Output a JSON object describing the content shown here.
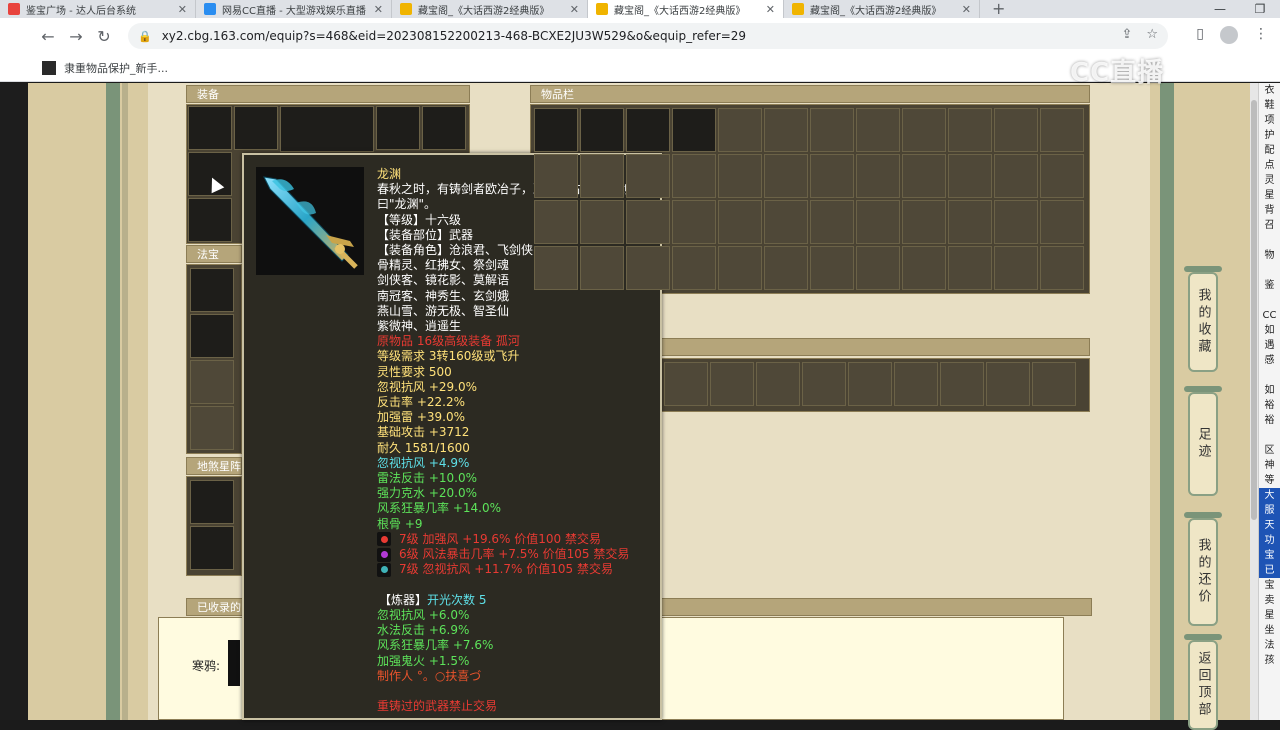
{
  "browser": {
    "tabs": [
      {
        "label": "鉴宝广场 - 达人后台系统",
        "favicon_color": "#e8433d",
        "active": false
      },
      {
        "label": "网易CC直播 - 大型游戏娱乐直播",
        "favicon_color": "#2a8df0",
        "active": false
      },
      {
        "label": "藏宝阁_《大话西游2经典版》",
        "favicon_color": "#f0b400",
        "active": false
      },
      {
        "label": "藏宝阁_《大话西游2经典版》",
        "favicon_color": "#f0b400",
        "active": true
      },
      {
        "label": "藏宝阁_《大话西游2经典版》",
        "favicon_color": "#f0b400",
        "active": false
      }
    ],
    "new_tab_glyph": "+",
    "window_controls": [
      "—",
      "❐"
    ],
    "url": "xy2.cbg.163.com/equip?s=468&eid=202308152200213-468-BCXE2JU3W529&o&equip_refer=29",
    "bookmark": "隶重物品保护_新手..."
  },
  "watermark": "CC直播",
  "page": {
    "equip_panel_title": "装备",
    "inventory_panel_title": "物品栏",
    "fabao_panel_title": "法宝",
    "star_panel_title": "地煞星阵",
    "shoulu_panel_title": "已收录的",
    "hanya_label": "寒鸦:",
    "side_buttons": [
      "我的收藏",
      "足迹",
      "我的还价",
      "返回顶部"
    ],
    "right_edge_chars": [
      "衣",
      "鞋",
      "项",
      "护",
      "配",
      "点",
      "灵",
      "星",
      "背",
      "召",
      "",
      "物",
      "",
      "鉴",
      "",
      "CC",
      "如",
      "遇",
      "感",
      "",
      "如",
      "裕",
      "裕",
      "",
      "区",
      "神",
      "等",
      "大",
      "服",
      "天",
      "功",
      "宝",
      "已",
      "宝",
      "卖",
      "星",
      "坐",
      "法",
      "孩"
    ]
  },
  "tooltip": {
    "name": "龙渊",
    "description": "春秋之时，有铸剑者欧冶子，冶铸旷古第一铁剑，名曰\"龙渊\"。",
    "level": "【等级】十六级",
    "slot": "【装备部位】武器",
    "roles_label": "【装备角色】沧浪君、飞剑侠",
    "roles": [
      "骨精灵、红拂女、祭剑魂",
      "剑侠客、镜花影、莫解语",
      "南冠客、神秀生、玄剑娥",
      "燕山雪、游无极、智圣仙",
      "紫微神、逍遥生"
    ],
    "origin": "原物品 16级高级装备 孤河",
    "requirements": [
      "等级需求 3转160级或飞升",
      "灵性要求 500"
    ],
    "base_stats": [
      "忽视抗风 +29.0%",
      "反击率 +22.2%",
      "加强雷 +39.0%",
      "基础攻击 +3712",
      "耐久 1581/1600"
    ],
    "extra_stat_cyan": "忽视抗风 +4.9%",
    "extra_stats": [
      "雷法反击 +10.0%",
      "强力克水 +20.0%",
      "风系狂暴几率 +14.0%",
      "根骨 +9"
    ],
    "gems": [
      {
        "text": "7级 加强风 +19.6% 价值100 禁交易",
        "color": "#e83a33"
      },
      {
        "text": "6级 风法暴击几率 +7.5% 价值105 禁交易",
        "color": "#b23ad6"
      },
      {
        "text": "7级 忽视抗风 +11.7% 价值105 禁交易",
        "color": "#3fb3b8"
      }
    ],
    "refine_label": "【炼器】",
    "refine_count": "开光次数 5",
    "refine_stats": [
      "忽视抗风 +6.0%",
      "水法反击 +6.9%",
      "风系狂暴几率 +7.6%",
      "加强鬼火 +1.5%"
    ],
    "maker": "制作人 °。○扶喜づ",
    "warning": "重铸过的武器禁止交易"
  }
}
